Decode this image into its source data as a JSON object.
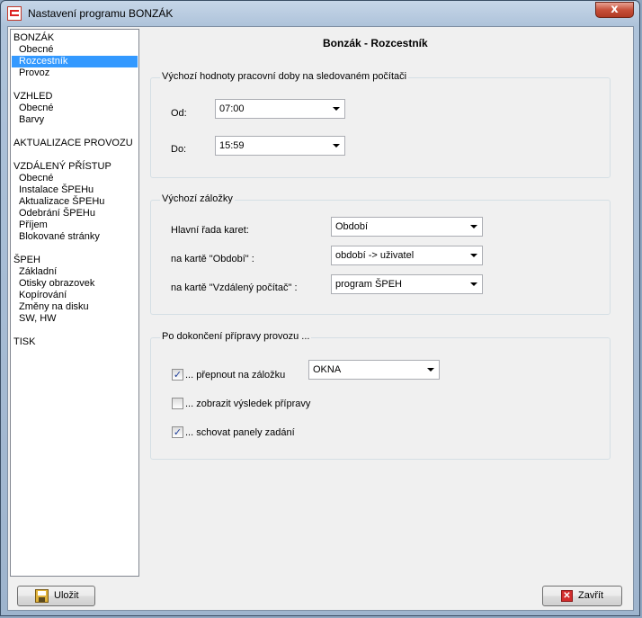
{
  "window": {
    "title": "Nastavení programu BONZÁK",
    "close_glyph": "x"
  },
  "nav": {
    "items": [
      {
        "label": "BONZÁK"
      },
      {
        "label": "Obecné"
      },
      {
        "label": "Rozcestník"
      },
      {
        "label": "Provoz"
      },
      {
        "label": "VZHLED"
      },
      {
        "label": "Obecné"
      },
      {
        "label": "Barvy"
      },
      {
        "label": "AKTUALIZACE PROVOZU"
      },
      {
        "label": "VZDÁLENÝ PŘÍSTUP"
      },
      {
        "label": "Obecné"
      },
      {
        "label": "Instalace ŠPEHu"
      },
      {
        "label": "Aktualizace ŠPEHu"
      },
      {
        "label": "Odebrání ŠPEHu"
      },
      {
        "label": "Příjem"
      },
      {
        "label": "Blokované stránky"
      },
      {
        "label": "ŠPEH"
      },
      {
        "label": "Základní"
      },
      {
        "label": "Otisky obrazovek"
      },
      {
        "label": "Kopírování"
      },
      {
        "label": "Změny na disku"
      },
      {
        "label": "SW, HW"
      },
      {
        "label": "TISK"
      }
    ]
  },
  "page": {
    "heading": "Bonzák - Rozcestník",
    "work_hours": {
      "title": "Výchozí hodnoty pracovní doby na sledovaném počítači",
      "from_label": "Od:",
      "from_value": "07:00",
      "to_label": "Do:",
      "to_value": "15:59"
    },
    "tabs": {
      "title": "Výchozí záložky",
      "main_label": "Hlavní řada karet:",
      "main_value": "Období",
      "period_label": "na kartě \"Období\" :",
      "period_value": "období -> uživatel",
      "remote_label": "na kartě \"Vzdálený počítač\" :",
      "remote_value": "program ŠPEH"
    },
    "after_prep": {
      "title": "Po dokončení přípravy provozu ...",
      "switch_label": "... přepnout na záložku",
      "switch_checked": true,
      "switch_value": "OKNA",
      "show_label": "... zobrazit výsledek přípravy",
      "show_checked": false,
      "hide_label": "... schovat panely zadání",
      "hide_checked": true
    }
  },
  "footer": {
    "save_label": "Uložit",
    "close_label": "Zavřít"
  }
}
